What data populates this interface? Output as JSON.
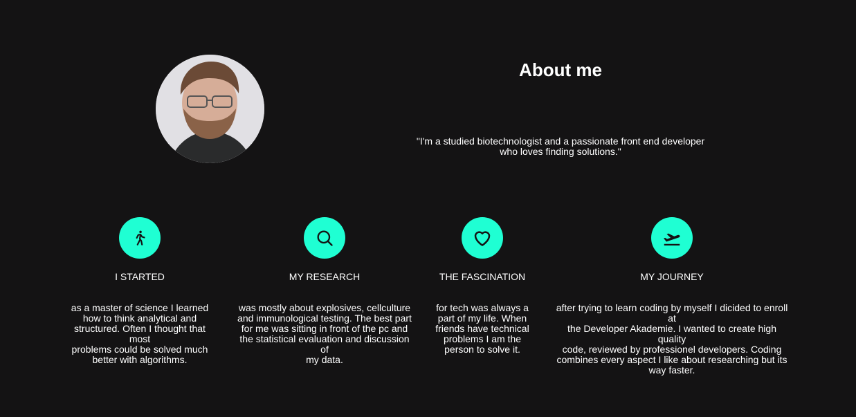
{
  "about": {
    "title": "About me",
    "quote_line1": "\"I'm a studied biotechnologist and a passionate front end developer",
    "quote_line2": "who loves finding solutions.\""
  },
  "colors": {
    "background": "#141314",
    "accent": "#1fffd3",
    "text": "#ffffff"
  },
  "cards": [
    {
      "icon": "walking-icon",
      "title": "I STARTED",
      "lines": [
        "as a master of science I learned",
        "how to think analytical and",
        "structured. Often I thought that most",
        "problems could be solved much",
        "better with algorithms."
      ]
    },
    {
      "icon": "search-icon",
      "title": "MY RESEARCH",
      "lines": [
        "was mostly about explosives, cellculture",
        "and immunological testing. The best part",
        "for me was sitting in front of the pc and",
        "the statistical evaluation and discussion of",
        "my data."
      ]
    },
    {
      "icon": "heart-icon",
      "title": "THE FASCINATION",
      "lines": [
        "for tech was always a",
        "part of my life. When",
        "friends have technical",
        "problems I am the",
        "person to solve it."
      ]
    },
    {
      "icon": "airplane-takeoff-icon",
      "title": "MY JOURNEY",
      "lines": [
        "after trying to learn coding by myself I dicided to enroll at",
        "the Developer Akademie. I wanted to create high quality",
        "code, reviewed by professionel developers. Coding",
        "combines every aspect I like about researching but its",
        "way faster."
      ]
    }
  ]
}
